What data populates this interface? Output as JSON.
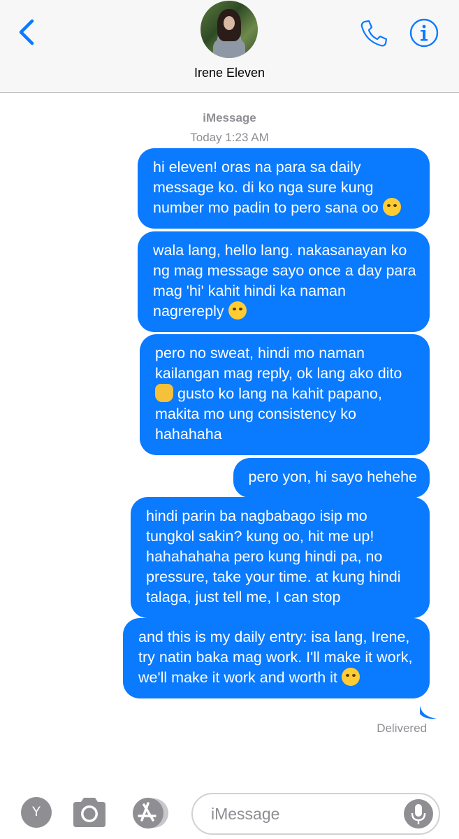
{
  "header": {
    "contact_name": "Irene Eleven"
  },
  "conversation": {
    "service_label": "iMessage",
    "timestamp": "Today 1:23 AM",
    "messages": [
      {
        "text": "hi eleven! oras na para sa daily message ko. di ko nga sure kung number mo padin to pero sana oo",
        "emoji": "sweat-smile-emoji"
      },
      {
        "text": "wala lang, hello lang. nakasanayan ko ng mag message sayo once a day para mag 'hi' kahit hindi ka naman nagrereply",
        "emoji": "grinning-squint-emoji"
      },
      {
        "text_before": "pero no sweat, hindi mo naman kailangan mag reply, ok lang ako dito",
        "emoji": "raised-fist-emoji",
        "text_after": "gusto ko lang na kahit papano, makita mo ung consistency ko hahahaha"
      },
      {
        "text": "pero yon, hi sayo hehehe"
      },
      {
        "text": "hindi parin ba nagbabago isip mo tungkol sakin? kung oo, hit me up! hahahahaha pero kung hindi pa, no pressure, take your time. at kung hindi talaga, just tell me, I can stop"
      },
      {
        "text": "and this is my daily entry: isa lang, Irene, try natin baka mag work. I'll make it work, we'll make it work and worth it",
        "emoji": "smiling-face-emoji"
      }
    ],
    "status": "Delivered"
  },
  "input_bar": {
    "apps_button_label": "Y",
    "placeholder": "iMessage"
  },
  "colors": {
    "accent": "#0a7aff",
    "bubble_text": "#ffffff",
    "meta_gray": "#8e8e93"
  },
  "icons": [
    "back-chevron-icon",
    "phone-icon",
    "info-icon",
    "camera-icon",
    "app-store-icon",
    "microphone-icon"
  ]
}
